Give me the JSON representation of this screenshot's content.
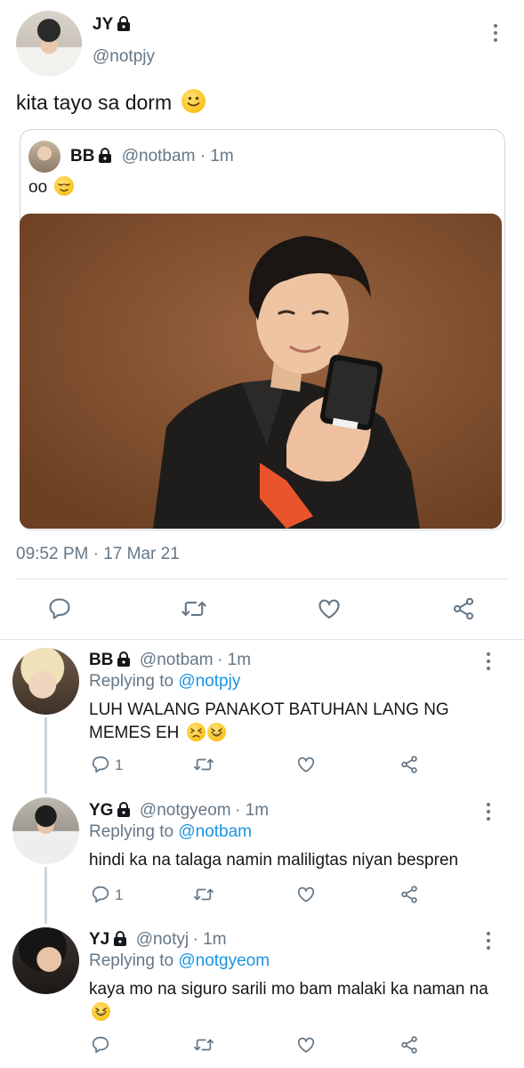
{
  "main_tweet": {
    "display_name": "JY",
    "handle": "@notpjy",
    "text": "kita tayo sa dorm",
    "text_emoji": "slightly-smiling-face",
    "timestamp": "09:52 PM · 17 Mar 21"
  },
  "quoted_tweet": {
    "display_name": "BB",
    "handle": "@notbam",
    "age": "· 1m",
    "text": "oo",
    "text_emoji": "relieved-face"
  },
  "actions": {
    "reply_icon": "reply-icon",
    "retweet_icon": "retweet-icon",
    "like_icon": "heart-icon",
    "share_icon": "share-icon"
  },
  "replying_to_label": "Replying to",
  "replies": [
    {
      "display_name": "BB",
      "handle": "@notbam",
      "age": "· 1m",
      "replying_to": "@notpjy",
      "text": "LUH WALANG PANAKOT BATUHAN LANG NG MEMES EH",
      "emojis": [
        "persevering-face",
        "grinning-squinting-face"
      ],
      "reply_count": "1"
    },
    {
      "display_name": "YG",
      "handle": "@notgyeom",
      "age": "· 1m",
      "replying_to": "@notbam",
      "text": "hindi ka na talaga namin maliligtas niyan bespren",
      "emojis": [],
      "reply_count": "1"
    },
    {
      "display_name": "YJ",
      "handle": "@notyj",
      "age": "· 1m",
      "replying_to": "@notgyeom",
      "text": "kaya mo na siguro sarili mo bam malaki ka naman na",
      "emojis": [
        "grinning-squinting-face"
      ],
      "reply_count": ""
    }
  ],
  "colors": {
    "text": "#14171a",
    "muted": "#657786",
    "link": "#1b95e0",
    "border": "#e1e8ed"
  }
}
